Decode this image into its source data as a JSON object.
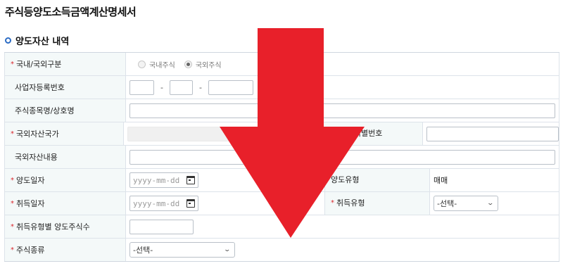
{
  "page": {
    "title": "주식등양도소득금액계산명세서"
  },
  "section": {
    "title": "양도자산 내역"
  },
  "rows": {
    "domestic_foreign": {
      "label": "국내/국외구분",
      "required": true,
      "options": [
        "국내주식",
        "국외주식"
      ],
      "selected": "국외주식"
    },
    "business_reg_no": {
      "label": "사업자등록번호"
    },
    "stock_name": {
      "label": "주식종목명/상호명"
    },
    "asset_country": {
      "label": "국외자산국가",
      "required": true,
      "isin_label": "국제증권식별번호"
    },
    "asset_content": {
      "label": "국외자산내용"
    },
    "transfer_date": {
      "label": "양도일자",
      "required": true,
      "placeholder": "yyyy-mm-dd",
      "type_label": "양도유형",
      "type_value": "매매"
    },
    "acquisition_date": {
      "label": "취득일자",
      "required": true,
      "placeholder": "yyyy-mm-dd",
      "type_label": "취득유형",
      "type_select": "-선택-"
    },
    "shares_by_type": {
      "label": "취득유형별 양도주식수",
      "required": true
    },
    "stock_type": {
      "label": "주식종류",
      "required": true,
      "select": "-선택-"
    }
  },
  "colors": {
    "required_mark": "#d9262c",
    "header_bg": "#f4f9f9",
    "arrow": "#e8202a",
    "section_icon": "#2c6cc4"
  },
  "icons": {
    "required": "*",
    "calendar": "calendar-icon",
    "chevron": "⌄"
  }
}
